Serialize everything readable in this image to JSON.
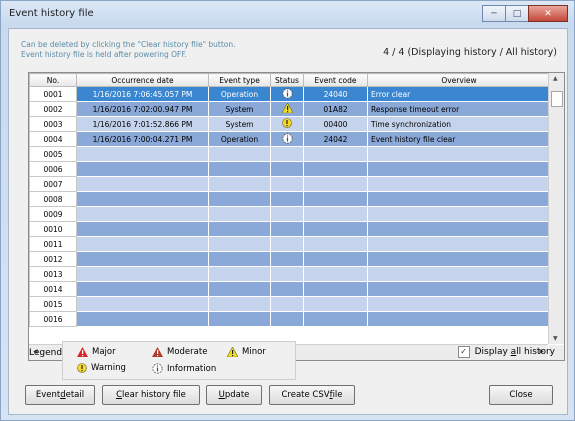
{
  "window": {
    "title": "Event history file"
  },
  "info": {
    "line1": "Can be deleted by clicking the \"Clear history file\" button.",
    "line2": "Event history file is held after powering OFF.",
    "count": "4 / 4 (Displaying history / All history)"
  },
  "table": {
    "headers": [
      "No.",
      "Occurrence date",
      "Event type",
      "Status",
      "Event code",
      "Overview"
    ],
    "rows": [
      {
        "no": "0001",
        "date": "1/16/2016 7:06:45.057 PM",
        "type": "Operation",
        "status": "information-icon",
        "code": "24040",
        "overview": "Error clear"
      },
      {
        "no": "0002",
        "date": "1/16/2016 7:02:00.947 PM",
        "type": "System",
        "status": "minor-icon",
        "code": "01A82",
        "overview": "Response timeout error"
      },
      {
        "no": "0003",
        "date": "1/16/2016 7:01:52.866 PM",
        "type": "System",
        "status": "warning-icon",
        "code": "00400",
        "overview": "Time synchronization"
      },
      {
        "no": "0004",
        "date": "1/16/2016 7:00:04.271 PM",
        "type": "Operation",
        "status": "information-icon",
        "code": "24042",
        "overview": "Event history file clear"
      },
      {
        "no": "0005"
      },
      {
        "no": "0006"
      },
      {
        "no": "0007"
      },
      {
        "no": "0008"
      },
      {
        "no": "0009"
      },
      {
        "no": "0010"
      },
      {
        "no": "0011"
      },
      {
        "no": "0012"
      },
      {
        "no": "0013"
      },
      {
        "no": "0014"
      },
      {
        "no": "0015"
      },
      {
        "no": "0016"
      }
    ],
    "selected_row": "0001"
  },
  "legend": {
    "label": "Legend",
    "major": "Major",
    "moderate": "Moderate",
    "minor": "Minor",
    "warning": "Warning",
    "information": "Information"
  },
  "display_all": {
    "pre": "Display ",
    "mnemonic": "a",
    "post": "ll history",
    "checked": true
  },
  "buttons": {
    "event_detail": {
      "pre": "Event ",
      "mnemonic": "d",
      "post": "etail"
    },
    "clear_history": {
      "pre": "",
      "mnemonic": "C",
      "post": "lear history file"
    },
    "update": {
      "pre": "",
      "mnemonic": "U",
      "post": "pdate"
    },
    "create_csv": {
      "pre": "Create CSV ",
      "mnemonic": "f",
      "post": "ile"
    },
    "close": "Close"
  },
  "colors": {
    "selected": "#3b86d1",
    "stripe_dark": "#8ba9d8",
    "stripe_light": "#c5d4ec",
    "info_text": "#5a8ca8"
  }
}
